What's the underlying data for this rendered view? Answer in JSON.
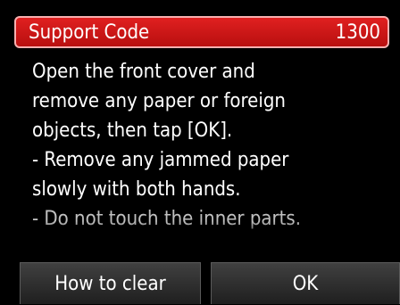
{
  "header": {
    "title": "Support Code",
    "code": "1300",
    "color": "#d01818"
  },
  "message": {
    "lines": [
      "Open the front cover and",
      "remove any paper or foreign",
      "objects, then tap [OK].",
      "- Remove any jammed paper",
      "slowly with both hands.",
      "- Do not touch the inner parts."
    ]
  },
  "buttons": {
    "how_to_clear": "How to clear",
    "ok": "OK"
  }
}
